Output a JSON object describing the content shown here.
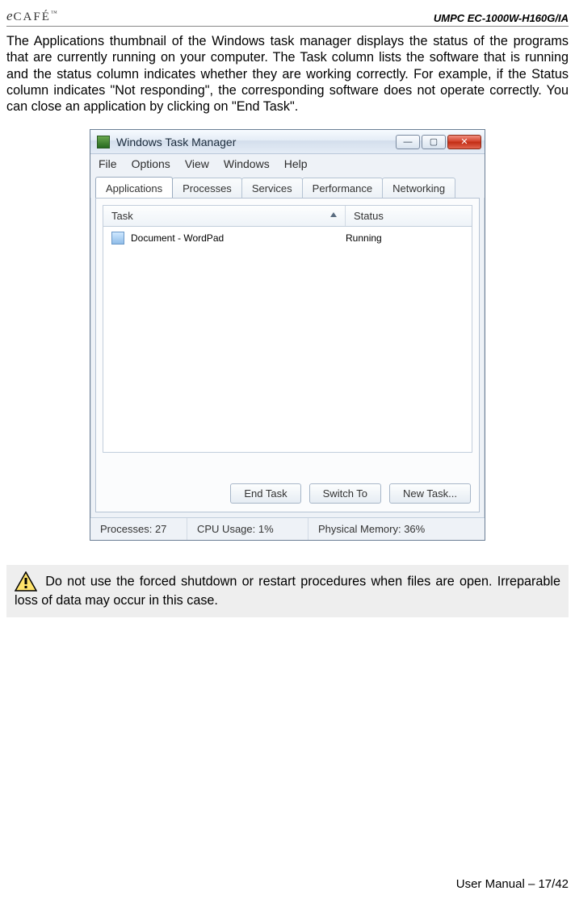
{
  "header": {
    "brand_prefix": "e",
    "brand_text": "CAFÉ",
    "brand_tm": "™",
    "product": "UMPC EC-1000W-H160G/IA"
  },
  "paragraph": "The Applications thumbnail of the Windows task manager displays the status of the programs that are currently running on your computer. The Task column lists the software that is running and the status column indicates whether they are working correctly. For example, if the Status column indicates \"Not responding\", the corresponding software does not operate correctly. You can close an application by clicking on \"End Task\".",
  "taskmgr": {
    "title": "Windows Task Manager",
    "menu": [
      "File",
      "Options",
      "View",
      "Windows",
      "Help"
    ],
    "tabs": [
      "Applications",
      "Processes",
      "Services",
      "Performance",
      "Networking"
    ],
    "active_tab": "Applications",
    "columns": {
      "task": "Task",
      "status": "Status"
    },
    "rows": [
      {
        "task": "Document - WordPad",
        "status": "Running"
      }
    ],
    "buttons": {
      "end_task": "End Task",
      "switch_to": "Switch To",
      "new_task": "New Task..."
    },
    "statusbar": {
      "processes_label": "Processes:",
      "processes_value": "27",
      "cpu_label": "CPU Usage:",
      "cpu_value": "1%",
      "mem_label": "Physical Memory:",
      "mem_value": "36%"
    },
    "window_controls": {
      "minimize": "—",
      "maximize": "▢",
      "close": "✕"
    }
  },
  "warning": " Do not use the forced shutdown or restart procedures when files are open. Irreparable loss of data may occur in this case.",
  "footer": "User Manual – 17/42"
}
